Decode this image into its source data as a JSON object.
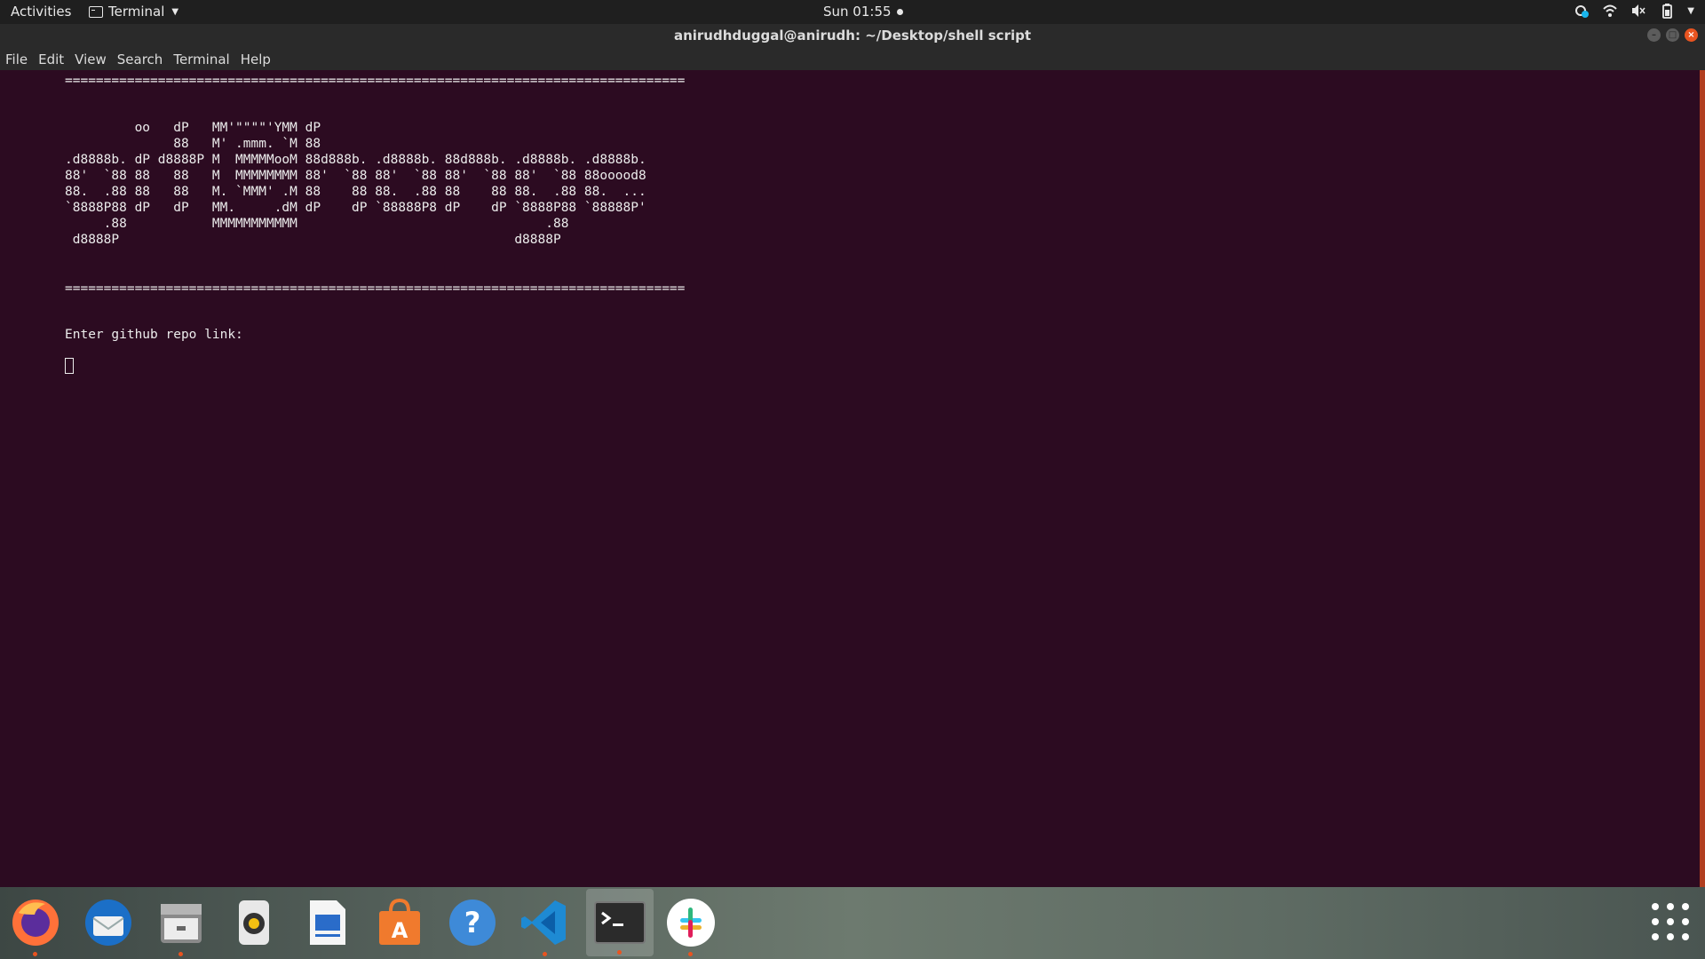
{
  "topbar": {
    "activities": "Activities",
    "app_menu_label": "Terminal",
    "clock": "Sun 01:55"
  },
  "window": {
    "title": "anirudhduggal@anirudh: ~/Desktop/shell script"
  },
  "menubar": {
    "items": [
      "File",
      "Edit",
      "View",
      "Search",
      "Terminal",
      "Help"
    ]
  },
  "terminal": {
    "separator_top": "================================================================================",
    "banner": [
      "         oo   dP   MM'\"\"\"\"'YMM dP",
      "              88   M' .mmm. `M 88",
      ".d8888b. dP d8888P M  MMMMMooM 88d888b. .d8888b. 88d888b. .d8888b. .d8888b.",
      "88'  `88 88   88   M  MMMMMMMM 88'  `88 88'  `88 88'  `88 88'  `88 88ooood8",
      "88.  .88 88   88   M. `MMM' .M 88    88 88.  .88 88    88 88.  .88 88.  ...",
      "`8888P88 dP   dP   MM.     .dM dP    dP `88888P8 dP    dP `8888P88 `88888P'",
      "     .88           MMMMMMMMMMM                                .88",
      " d8888P                                                   d8888P"
    ],
    "separator_bottom": "================================================================================",
    "prompt": "Enter github repo link:"
  },
  "dock": {
    "apps": [
      "firefox-icon",
      "thunderbird-icon",
      "files-icon",
      "rhythmbox-icon",
      "libreoffice-writer-icon",
      "software-center-icon",
      "help-icon",
      "vscode-icon",
      "terminal-icon",
      "slack-icon"
    ]
  },
  "colors": {
    "terminal_bg": "#2c0b21",
    "accent": "#e95420"
  }
}
